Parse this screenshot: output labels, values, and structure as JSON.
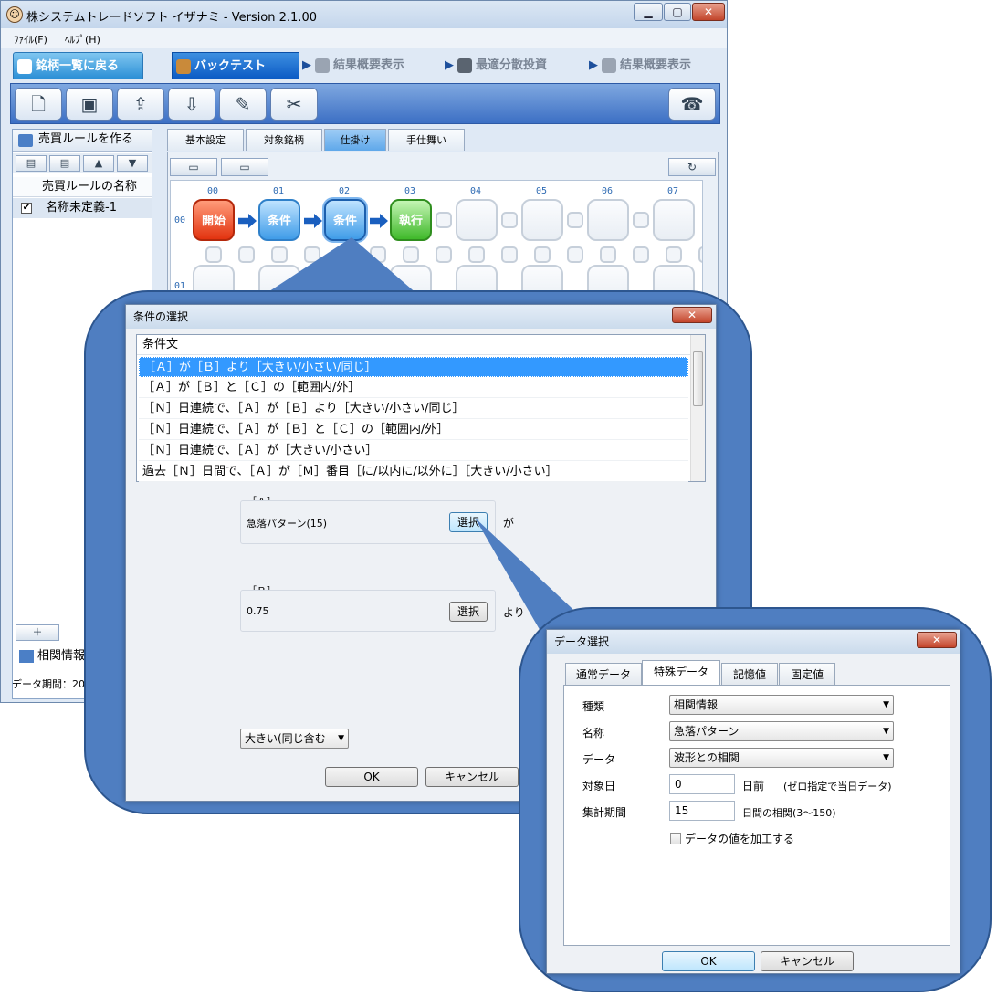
{
  "main_window": {
    "title": "株システムトレードソフト イザナミ - Version 2.1.00",
    "menu": [
      "ﾌｧｲﾙ(F)",
      "ﾍﾙﾌﾟ(H)"
    ],
    "nav_tabs": [
      "銘柄一覧に戻る",
      "バックテスト",
      "結果概要表示",
      "最適分散投資",
      "結果概要表示"
    ],
    "rule_panel": {
      "title": "売買ルールを作る",
      "column_header": "売買ルールの名称",
      "rules": [
        {
          "checked": "✔",
          "name": "名称未定義-1"
        }
      ],
      "footer_label": "相関情報",
      "status": "データ期間：20"
    },
    "sub_tabs": [
      "基本設定",
      "対象銘柄",
      "仕掛け",
      "手仕舞い"
    ],
    "active_sub_tab": "仕掛け",
    "flow": {
      "columns": [
        "00",
        "01",
        "02",
        "03",
        "04",
        "05",
        "06",
        "07"
      ],
      "rows": [
        "00",
        "01"
      ],
      "nodes": [
        "開始",
        "条件",
        "条件",
        "執行"
      ]
    }
  },
  "condition_dialog": {
    "title": "条件の選択",
    "list_header": "条件文",
    "conditions": [
      "［Ａ］が［Ｂ］より［大きい/小さい/同じ］",
      "［Ａ］が［Ｂ］と［Ｃ］の［範囲内/外］",
      "［Ｎ］日連続で、［Ａ］が［Ｂ］より［大きい/小さい/同じ］",
      "［Ｎ］日連続で、［Ａ］が［Ｂ］と［Ｃ］の［範囲内/外］",
      "［Ｎ］日連続で、［Ａ］が［大きい/小さい］",
      "過去［Ｎ］日間で、［Ａ］が［Ｍ］番目［に/以内に/以外に］［大きい/小さい］"
    ],
    "selected_index": 0,
    "param_a": {
      "label": "［Ａ］",
      "value": "急落パターン(15)",
      "button": "選択",
      "suffix": "が"
    },
    "param_b": {
      "label": "［Ｂ］",
      "value": "0.75",
      "button": "選択",
      "suffix": "より（と）"
    },
    "comparison": "大きい(同じ含む",
    "ok": "OK",
    "cancel": "キャンセル"
  },
  "data_dialog": {
    "title": "データ選択",
    "tabs": [
      "通常データ",
      "特殊データ",
      "記憶値",
      "固定値"
    ],
    "active_tab": "特殊データ",
    "fields": {
      "kind_label": "種類",
      "kind_value": "相関情報",
      "name_label": "名称",
      "name_value": "急落パターン",
      "data_label": "データ",
      "data_value": "波形との相関",
      "target_day_label": "対象日",
      "target_day_value": "0",
      "target_day_suffix": "日前",
      "target_day_note": "(ゼロ指定で当日データ)",
      "period_label": "集計期間",
      "period_value": "15",
      "period_suffix": "日間の相関(3～150)",
      "process_checkbox": "データの値を加工する"
    },
    "ok": "OK",
    "cancel": "キャンセル"
  },
  "colors": {
    "callout_fill": "#4f7ec1",
    "selection": "#3399ff",
    "start_node": "#e2330f",
    "condition_node": "#3f9ce8",
    "execute_node": "#3fb92a"
  }
}
